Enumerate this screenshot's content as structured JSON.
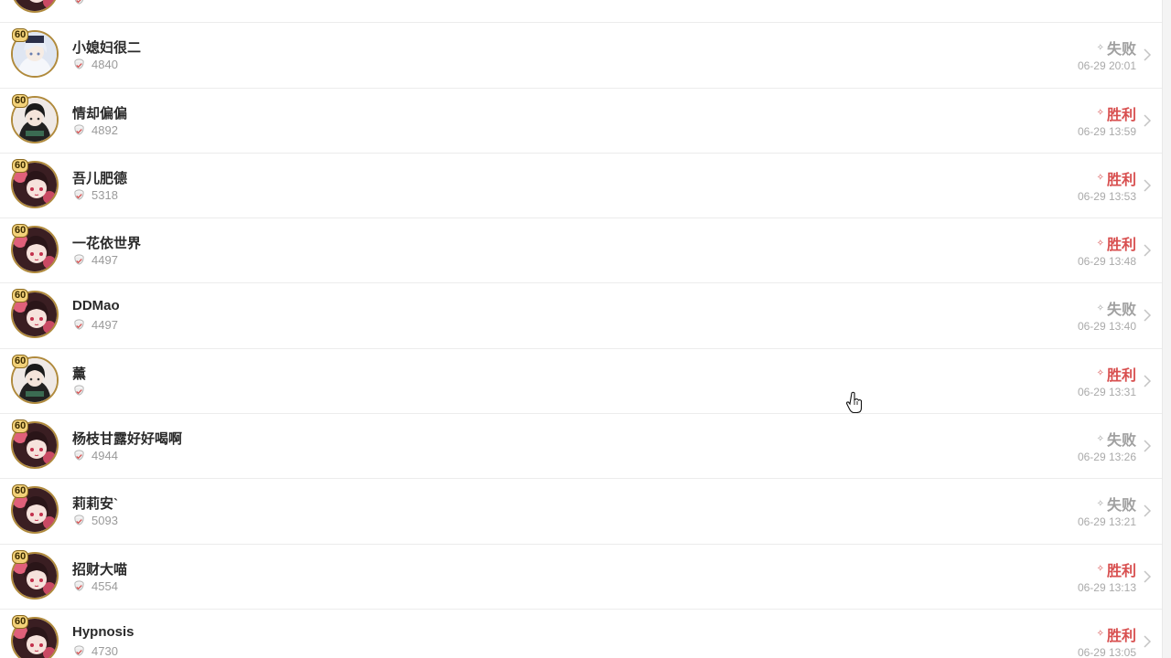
{
  "matches": [
    {
      "name": "",
      "level": "60",
      "score": "",
      "result": "",
      "outcome": "none",
      "time": "",
      "avatar": "pink"
    },
    {
      "name": "小媳妇很二",
      "level": "60",
      "score": "4840",
      "result": "失败",
      "outcome": "lose",
      "time": "06-29 20:01",
      "avatar": "white"
    },
    {
      "name": "情却偏偏",
      "level": "60",
      "score": "4892",
      "result": "胜利",
      "outcome": "win",
      "time": "06-29 13:59",
      "avatar": "dark"
    },
    {
      "name": "吾儿肥德",
      "level": "60",
      "score": "5318",
      "result": "胜利",
      "outcome": "win",
      "time": "06-29 13:53",
      "avatar": "pink"
    },
    {
      "name": "一花依世界",
      "level": "60",
      "score": "4497",
      "result": "胜利",
      "outcome": "win",
      "time": "06-29 13:48",
      "avatar": "pink"
    },
    {
      "name": "DDMao",
      "level": "60",
      "score": "4497",
      "result": "失败",
      "outcome": "lose",
      "time": "06-29 13:40",
      "avatar": "pink"
    },
    {
      "name": "薰",
      "level": "60",
      "score": "",
      "result": "胜利",
      "outcome": "win",
      "time": "06-29 13:31",
      "avatar": "dark"
    },
    {
      "name": "杨枝甘露好好喝啊",
      "level": "60",
      "score": "4944",
      "result": "失败",
      "outcome": "lose",
      "time": "06-29 13:26",
      "avatar": "pink"
    },
    {
      "name": "莉莉安`",
      "level": "60",
      "score": "5093",
      "result": "失败",
      "outcome": "lose",
      "time": "06-29 13:21",
      "avatar": "pink"
    },
    {
      "name": "招财大喵",
      "level": "60",
      "score": "4554",
      "result": "胜利",
      "outcome": "win",
      "time": "06-29 13:13",
      "avatar": "pink"
    },
    {
      "name": "Hypnosis",
      "level": "60",
      "score": "4730",
      "result": "胜利",
      "outcome": "win",
      "time": "06-29 13:05",
      "avatar": "pink"
    }
  ],
  "icons": {
    "score": "trophy-cup-icon",
    "arrow": "chevron-right-icon",
    "result_marker": "diamond-icon"
  },
  "colors": {
    "win": "#d85050",
    "lose": "#a0a0a0",
    "avatar_ring": "#b08a3c"
  }
}
